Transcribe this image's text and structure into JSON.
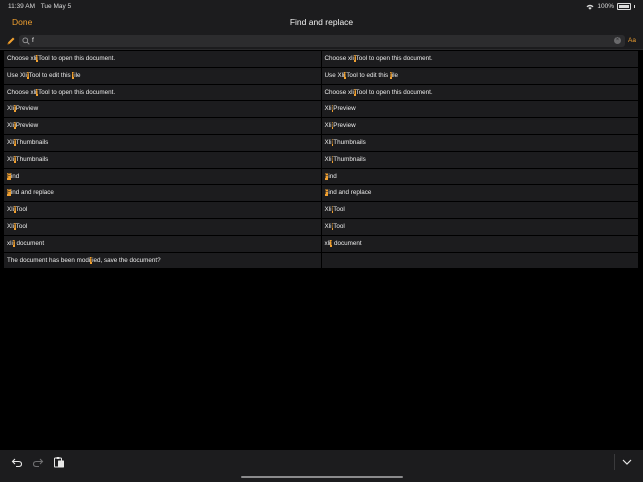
{
  "status": {
    "time": "11:39 AM",
    "date": "Tue May 5",
    "battery": "100%"
  },
  "nav": {
    "done_label": "Done",
    "title": "Find and replace"
  },
  "search": {
    "query": "f",
    "case_label": "Aa"
  },
  "rows": [
    {
      "left": [
        [
          "Choose xli",
          ""
        ],
        [
          "f",
          "m"
        ],
        [
          "Tool to open this document.",
          ""
        ]
      ],
      "right": [
        [
          "Choose xli",
          ""
        ],
        [
          "f",
          "m"
        ],
        [
          "Tool to open this document.",
          ""
        ]
      ]
    },
    {
      "left": [
        [
          "Use Xli",
          ""
        ],
        [
          "f",
          "m"
        ],
        [
          "Tool to edit this ",
          ""
        ],
        [
          "f",
          "m"
        ],
        [
          "ile",
          ""
        ]
      ],
      "right": [
        [
          "Use Xli",
          ""
        ],
        [
          "f",
          "m"
        ],
        [
          "Tool to edit this ",
          ""
        ],
        [
          "f",
          "m"
        ],
        [
          "ile",
          ""
        ]
      ]
    },
    {
      "left": [
        [
          "Choose xli",
          ""
        ],
        [
          "f",
          "m"
        ],
        [
          "Tool to open this document.",
          ""
        ]
      ],
      "right": [
        [
          "Choose xli",
          ""
        ],
        [
          "f",
          "m"
        ],
        [
          "Tool to open this document.",
          ""
        ]
      ]
    },
    {
      "left": [
        [
          "Xli",
          ""
        ],
        [
          "f",
          "m"
        ],
        [
          "Preview",
          ""
        ]
      ],
      "right": [
        [
          "Xli",
          ""
        ],
        [
          "f",
          "m"
        ],
        [
          "Preview",
          ""
        ]
      ]
    },
    {
      "left": [
        [
          "Xli",
          ""
        ],
        [
          "f",
          "m"
        ],
        [
          "Preview",
          ""
        ]
      ],
      "right": [
        [
          "Xli",
          ""
        ],
        [
          "f",
          "m"
        ],
        [
          "Preview",
          ""
        ]
      ]
    },
    {
      "left": [
        [
          "Xli",
          ""
        ],
        [
          "f",
          "m"
        ],
        [
          "Thumbnails",
          ""
        ]
      ],
      "right": [
        [
          "Xli",
          ""
        ],
        [
          "f",
          "m"
        ],
        [
          "Thumbnails",
          ""
        ]
      ]
    },
    {
      "left": [
        [
          "Xli",
          ""
        ],
        [
          "f",
          "m"
        ],
        [
          "Thumbnails",
          ""
        ]
      ],
      "right": [
        [
          "Xli",
          ""
        ],
        [
          "f",
          "m"
        ],
        [
          "Thumbnails",
          ""
        ]
      ]
    },
    {
      "left": [
        [
          "F",
          "m"
        ],
        [
          "ind",
          ""
        ]
      ],
      "right": [
        [
          "F",
          "m"
        ],
        [
          "ind",
          ""
        ]
      ]
    },
    {
      "left": [
        [
          "F",
          "m"
        ],
        [
          "ind and replace",
          ""
        ]
      ],
      "right": [
        [
          "F",
          "m"
        ],
        [
          "ind and replace",
          ""
        ]
      ]
    },
    {
      "left": [
        [
          "Xli",
          ""
        ],
        [
          "f",
          "m"
        ],
        [
          "Tool",
          ""
        ]
      ],
      "right": [
        [
          "Xli",
          ""
        ],
        [
          "f",
          "m"
        ],
        [
          "Tool",
          ""
        ]
      ]
    },
    {
      "left": [
        [
          "Xli",
          ""
        ],
        [
          "f",
          "m"
        ],
        [
          "Tool",
          ""
        ]
      ],
      "right": [
        [
          "Xli",
          ""
        ],
        [
          "f",
          "m"
        ],
        [
          "Tool",
          ""
        ]
      ]
    },
    {
      "left": [
        [
          "xli",
          ""
        ],
        [
          "f",
          "m"
        ],
        [
          " document",
          ""
        ]
      ],
      "right": [
        [
          "xli",
          ""
        ],
        [
          "f",
          "m"
        ],
        [
          " document",
          ""
        ]
      ]
    },
    {
      "left": [
        [
          "The document has been modi",
          ""
        ],
        [
          "f",
          "m"
        ],
        [
          "ied, save the document?",
          ""
        ]
      ],
      "right": []
    }
  ],
  "colors": {
    "accent": "#f0a030",
    "background": "#000000",
    "cell": "#1c1c1e"
  },
  "icons": [
    "pencil-icon",
    "search-icon",
    "clear-icon",
    "undo-icon",
    "redo-icon",
    "paste-icon",
    "chevron-down-icon",
    "wifi-icon",
    "battery-icon"
  ]
}
